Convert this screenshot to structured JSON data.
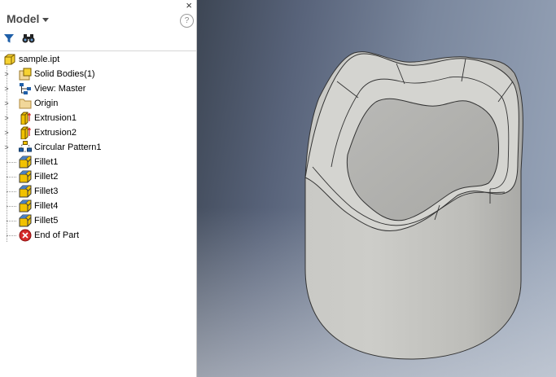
{
  "panel": {
    "title": "Model",
    "close_glyph": "×",
    "help_glyph": "?"
  },
  "tree": {
    "root": {
      "label": "sample.ipt",
      "icon": "part-file-icon"
    },
    "items": [
      {
        "label": "Solid Bodies(1)",
        "icon": "solid-bodies-icon",
        "expandable": true
      },
      {
        "label": "View: Master",
        "icon": "view-icon",
        "expandable": true
      },
      {
        "label": "Origin",
        "icon": "folder-icon",
        "expandable": true
      },
      {
        "label": "Extrusion1",
        "icon": "extrusion-icon",
        "expandable": true
      },
      {
        "label": "Extrusion2",
        "icon": "extrusion-icon",
        "expandable": true
      },
      {
        "label": "Circular Pattern1",
        "icon": "circular-pattern-icon",
        "expandable": true
      },
      {
        "label": "Fillet1",
        "icon": "fillet-icon",
        "expandable": false
      },
      {
        "label": "Fillet2",
        "icon": "fillet-icon",
        "expandable": false
      },
      {
        "label": "Fillet3",
        "icon": "fillet-icon",
        "expandable": false
      },
      {
        "label": "Fillet4",
        "icon": "fillet-icon",
        "expandable": false
      },
      {
        "label": "Fillet5",
        "icon": "fillet-icon",
        "expandable": false
      },
      {
        "label": "End of Part",
        "icon": "end-of-part-icon",
        "expandable": false
      }
    ]
  },
  "colors": {
    "accent_blue": "#1f5fa8",
    "feature_yellow": "#f2c200",
    "end_red": "#d52a2a"
  }
}
